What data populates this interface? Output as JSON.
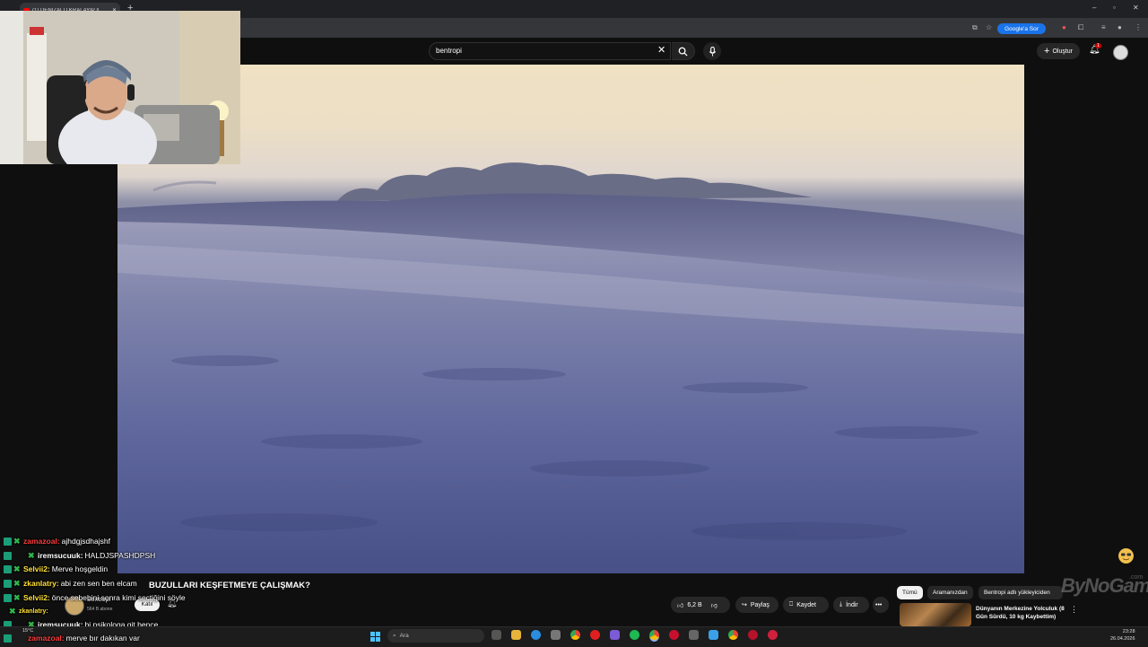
{
  "browser": {
    "tab_title": "(1) DENİZALTI KRALAYIP ||",
    "new_tab": "+",
    "ask_google": "Google'a Sor",
    "minimize": "–",
    "maximize": "▫",
    "close": "✕"
  },
  "youtube": {
    "search_value": "bentropi",
    "create_label": "Oluştur",
    "notif_count": "1"
  },
  "video": {
    "title": "BUZULLARI KEŞFETMEYE ÇALIŞMAK?",
    "channel": "Bentropi",
    "subscribers": "564 B abone",
    "join_label": "Katıl",
    "like_count": "6,2 B",
    "share_label": "Paylaş",
    "save_label": "Kaydet",
    "download_label": "İndir",
    "more_label": "•••"
  },
  "chips": [
    "Tümü",
    "Aramanızdan",
    "Bentropi adlı yükleyiciden"
  ],
  "recommendation": {
    "title": "Dünyanın Merkezine Yolculuk (8 Gün Sürdü, 10 kg Kaybettim)"
  },
  "watermark": {
    "text": "ByNoGame",
    "suffix": ".com"
  },
  "chat": [
    {
      "user": "zamazoal:",
      "message": "ajhdgjsdhajshf",
      "color": "#ff3b3b"
    },
    {
      "user": "iremsucuuk:",
      "message": "HALDJSPASHDPSH",
      "color": "#ffffff"
    },
    {
      "user": "Selvii2:",
      "message": "Merve hoşgeldin",
      "color": "#ffe033"
    },
    {
      "user": "zkanlatry:",
      "message": "abi zen sen ben elcam",
      "color": "#ffe033"
    },
    {
      "user": "Selvii2:",
      "message": "önce sebebini sonra kimi seçtiğini söyle",
      "color": "#ffe033"
    },
    {
      "user": "zkanlatry:",
      "message": "",
      "color": "#ffe033"
    },
    {
      "user": "iremsucuuk:",
      "message": "bi psikologa git bence",
      "color": "#ffffff"
    },
    {
      "user": "zamazoal:",
      "message": "merve bır dakıkan var",
      "color": "#ff3b3b"
    }
  ],
  "taskbar": {
    "search_placeholder": "Ara",
    "temperature": "15°C",
    "time": "23:28",
    "date": "26.04.2026"
  },
  "colors": {
    "youtube_bg": "#0f0f0f",
    "youtube_red": "#ff0000",
    "google_blue": "#1a73e8"
  }
}
